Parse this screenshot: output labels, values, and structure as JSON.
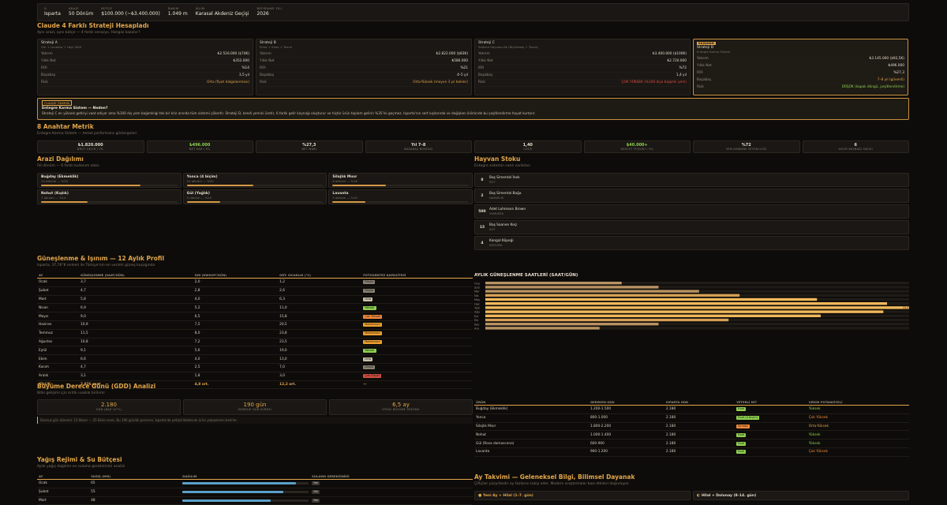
{
  "header": {
    "il_label": "İL",
    "il": "Isparta",
    "arazi_label": "ARAZİ",
    "arazi": "50 Dönüm",
    "butce_label": "BÜTÇE",
    "butce": "$100.000 (~₺3.400.000)",
    "rakim_label": "RAKIM",
    "rakim": "1.049 m",
    "iklim_label": "İKLİM",
    "iklim": "Karasal Akdeniz Geçişi",
    "yil_label": "REFERANS YILI",
    "yil": "2026"
  },
  "strategies": {
    "title": "Claude 4 Farklı Strateji Hesapladı",
    "subtitle": "Aynı arazi, aynı bütçe — 4 farklı senaryo. Hangisi kazanır?",
    "cards": [
      {
        "name": "Strateji A",
        "desc": "Gül + Lavanta + Hayl Sütü",
        "rows": [
          [
            "Yatırım",
            "₺2.516.000 ($74K)"
          ],
          [
            "Yıllık Net",
            "₺352.000"
          ],
          [
            "ROI",
            "%14"
          ],
          [
            "Başabaş",
            "3,5 yıl"
          ],
          [
            "Risk",
            "Orta (fiyat dalgalanması)"
          ]
        ],
        "winner": false,
        "badge": ""
      },
      {
        "name": "Strateji B",
        "desc": "Elma + Kiraz + Tavuk",
        "rows": [
          [
            "Yatırım",
            "₺2.822.000 ($83K)"
          ],
          [
            "Yıllık Net",
            "₺580.000"
          ],
          [
            "ROI",
            "%21"
          ],
          [
            "Başabaş",
            "4–5 yıl"
          ],
          [
            "Risk",
            "Orta-Yüksek (meyve 3 yıl bekler)"
          ]
        ],
        "winner": false,
        "badge": ""
      },
      {
        "name": "Strateji C",
        "desc": "Sadece Hayvancılık (Büyükbaş + Tavuk)",
        "rows": [
          [
            "Yatırım",
            "₺3.400.000 ($100K)"
          ],
          [
            "Yıllık Net",
            "₺2.720.000"
          ],
          [
            "IRR",
            "%72"
          ],
          [
            "Başabaş",
            "1,4 yıl"
          ],
          [
            "Risk",
            "ÇOK YÜKSEK (%100 dışa bağımlı yem)"
          ]
        ],
        "winner": false,
        "badge": ""
      },
      {
        "name": "Strateji D",
        "desc": "Entegre Karma Sistem",
        "rows": [
          [
            "Yatırım",
            "₺3.145.000 ($92,5K)"
          ],
          [
            "Yıllık Net",
            "₺496.000"
          ],
          [
            "ROI",
            "%27,3"
          ],
          [
            "Başabaş",
            "7–8 yıl (güvenli)"
          ],
          [
            "Risk",
            "DÜŞÜK (kapalı döngü, çeşitlendirme)"
          ]
        ],
        "winner": true,
        "badge": "KAZANAN"
      }
    ]
  },
  "recommendation": {
    "badge": "CLAUDE ÖNERİSİ",
    "title": "Entegre Karma Sistem — Neden?",
    "text": "Strateji C en yüksek getiriyi vaat ediyor ama %100 dış yem bağımlılığı tek bir kriz anında tüm sistemi çökertir. Strateji D, kendi yemini üretir, 6 farklı gelir kaynağı oluşturur ve hiçbir ürün toplam gelirin %35'ini geçmez. Isparta'nın sert kışlarında ve değişken ikliminde bu çeşitlendirme hayat kurtarır."
  },
  "metrics": {
    "title": "8 Anahtar Metrik",
    "subtitle": "Entegre Karma Sistem — temel performans göstergeleri",
    "items": [
      {
        "value": "₺1.820.000",
        "label": "BRÜT GELİR / YIL"
      },
      {
        "value": "₺496.000",
        "label": "NET KAR / YIL"
      },
      {
        "value": "%27,3",
        "label": "NET MARJ"
      },
      {
        "value": "Yıl 7–8",
        "label": "BAŞABAŞ NOKTASI"
      },
      {
        "value": "1,40",
        "label": "CDCR"
      },
      {
        "value": "$40.000+",
        "label": "DEVLET TEŞVİKİ / YIL"
      },
      {
        "value": "%72",
        "label": "YEM KENDİNE YETERLİLİĞİ"
      },
      {
        "value": "6",
        "label": "GELİR KAYNAĞI SAYISI"
      }
    ]
  },
  "land": {
    "title": "Arazi Dağılımı",
    "subtitle": "50 dönüm — 6 farklı kullanım alanı",
    "items": [
      {
        "name": "Buğday (Ekmeklik)",
        "info": "15 dönüm — %30",
        "pct": 0.6
      },
      {
        "name": "Yonca (4 biçim)",
        "info": "10 dönüm — %20",
        "pct": 0.4
      },
      {
        "name": "Silajlık Mısır",
        "info": "8 dönüm — %16",
        "pct": 0.32
      },
      {
        "name": "Nohut (Kışlık)",
        "info": "7 dönüm — %14",
        "pct": 0.28
      },
      {
        "name": "Gül (Yağlık)",
        "info": "5 dönüm — %10",
        "pct": 0.2
      },
      {
        "name": "Lavanta",
        "info": "5 dönüm — %10",
        "pct": 0.2
      }
    ]
  },
  "livestock": {
    "title": "Hayvan Stoku",
    "subtitle": "Entegre sistemin canlı varlıkları",
    "items": [
      {
        "count": "8",
        "name": "Baş Simental İnek",
        "tag": "SÜT"
      },
      {
        "count": "2",
        "name": "Baş Simental Boğa",
        "tag": "DAMIZLIK"
      },
      {
        "count": "500",
        "name": "Adet Lohmann Brown",
        "tag": "YUMURTA"
      },
      {
        "count": "15",
        "name": "Baş Saanen Keçi",
        "tag": "SÜT"
      },
      {
        "count": "4",
        "name": "Kangal Köpeği",
        "tag": "KORUMA"
      }
    ]
  },
  "sun": {
    "title": "Güneşlenme & Işınım — 12 Aylık Profil",
    "subtitle": "Isparta, 37,76°K enlemi ile Türkiye'nin en verimli güneş kuşağında",
    "headers": [
      "AY",
      "GÜNEŞLENME (SAAT/GÜN)",
      "GHI (KWH/M²/GÜN)",
      "ORT. SICAKLIK (°C)",
      "FOTOSENTEZ KAPASİTESİ"
    ],
    "rows": [
      [
        "Ocak",
        "3,7",
        "2,0",
        "1,2",
        "Düşük",
        "#8a8275"
      ],
      [
        "Şubat",
        "4,7",
        "2,8",
        "2,6",
        "Düşük",
        "#8a8275"
      ],
      [
        "Mart",
        "5,8",
        "4,0",
        "6,3",
        "Orta",
        "#c8bfa8"
      ],
      [
        "Nisan",
        "6,9",
        "5,2",
        "11,0",
        "Yüksek",
        "#8fd14f"
      ],
      [
        "Mayıs",
        "9,0",
        "6,5",
        "15,8",
        "Çok Yüksek",
        "#f08a3c"
      ],
      [
        "Haziran",
        "10,9",
        "7,5",
        "20,5",
        "Maksimum",
        "#f0a030"
      ],
      [
        "Temmuz",
        "11,5",
        "8,0",
        "23,8",
        "Maksimum",
        "#f0a030"
      ],
      [
        "Ağustos",
        "10,8",
        "7,2",
        "23,5",
        "Maksimum",
        "#f0a030"
      ],
      [
        "Eylül",
        "9,1",
        "5,6",
        "19,0",
        "Yüksek",
        "#8fd14f"
      ],
      [
        "Ekim",
        "6,6",
        "4,0",
        "13,0",
        "Orta",
        "#c8bfa8"
      ],
      [
        "Kasım",
        "4,7",
        "2,5",
        "7,0",
        "Düşük",
        "#8a8275"
      ],
      [
        "Aralık",
        "3,1",
        "1,8",
        "3,0",
        "Çok Düşük",
        "#d05040"
      ]
    ],
    "total": [
      "YILLIK",
      "2.826 saat",
      "4,8 ort.",
      "12,2 ort.",
      "—"
    ]
  },
  "chart_data": {
    "type": "bar",
    "title": "AYLIK GÜNEŞLENME SAATLERİ (SAAT/GÜN)",
    "categories": [
      "Oca",
      "Şub",
      "Mar",
      "Nis",
      "May",
      "Haz",
      "Tem",
      "Ağu",
      "Eyl",
      "Eki",
      "Kas",
      "Ara"
    ],
    "values": [
      3.7,
      4.7,
      5.8,
      6.9,
      9.0,
      10.9,
      11.5,
      10.8,
      9.1,
      6.6,
      4.7,
      3.1
    ],
    "max_label": "11,5",
    "xlim": [
      0,
      11.5
    ]
  },
  "gdd": {
    "title": "Büyüme Derece Günü (GDD) Analizi",
    "subtitle": "Bitki gelişimi için kritik ısıaklık birikimi",
    "cards": [
      {
        "value": "2.180",
        "label": "GDD (BAZ 10°C)"
      },
      {
        "value": "190 gün",
        "label": "DONSUZ GÜN SÜRESİ"
      },
      {
        "value": "6,5 ay",
        "label": "ETKİLİ BÜYÜME SEZONU"
      }
    ],
    "note": "Donsuz gün dönemi: 15 Nisan — 25 Ekim arası. Bu 190 günlük pencere, Isparta'da yetiştirilebilecek ürün yelpazesini belirler.",
    "headers": [
      "ÜRÜN",
      "GEREKEN GDD",
      "ISPARTA GDD",
      "YETERLİ Mİ?",
      "VERİM POTANSİYELİ"
    ],
    "rows": [
      [
        "Buğday (Ekmeklik)",
        "1.200-1.500",
        "2.180",
        "Evet",
        "#8fd14f",
        "Yüksek",
        "#8fd14f"
      ],
      [
        "Yonca",
        "800-1.000",
        "2.180",
        "Evet (4 biçim)",
        "#8fd14f",
        "Çok Yüksek",
        "#f08a3c"
      ],
      [
        "Silajlık Mısır",
        "1.800-2.200",
        "2.180",
        "Sınırda",
        "#f08a3c",
        "Orta-Yüksek",
        "#e3a64a"
      ],
      [
        "Nohut",
        "1.000-1.400",
        "2.180",
        "Evet",
        "#8fd14f",
        "Yüksek",
        "#8fd14f"
      ],
      [
        "Gül (Rosa damascena)",
        "600-900",
        "2.180",
        "Evet",
        "#8fd14f",
        "Yüksek",
        "#8fd14f"
      ],
      [
        "Lavanta",
        "900-1.200",
        "2.180",
        "Evet",
        "#8fd14f",
        "Çok Yüksek",
        "#f08a3c"
      ]
    ]
  },
  "rain": {
    "title": "Yağış Rejimi & Su Bütçesi",
    "subtitle": "Aylık yağış dağılımı ve sulama gereksinimi analizi",
    "headers": [
      "AY",
      "YAĞIŞ (MM)",
      "DAĞILIM",
      "SULAMA GEREKSİNİMİ"
    ],
    "rows": [
      [
        "Ocak",
        "65",
        0.9,
        "Yok"
      ],
      [
        "Şubat",
        "55",
        0.8,
        "Yok"
      ],
      [
        "Mart",
        "48",
        0.7,
        "Yok"
      ]
    ]
  },
  "calendar": {
    "title": "Ay Takvimi — Geleneksel Bilgi, Bilimsel Dayanak",
    "subtitle": "Çiftçiler yüzyıllardır ay fazlarını takip eder. Modern araştırmalar bazı etkileri doğruluyor.",
    "left": "Yeni Ay + Hilal (1–7. gün)",
    "right": "Hilal + Dolunay (8–14. gün)"
  },
  "colors": {
    "accent": "#e3a64a",
    "bg": "#0e0c0a",
    "panel": "#1a1714"
  }
}
